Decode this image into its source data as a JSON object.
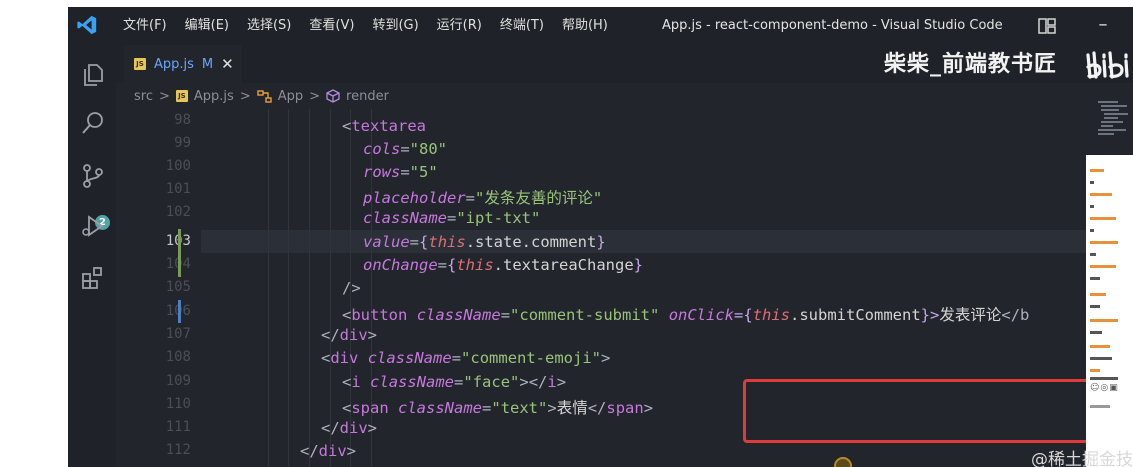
{
  "titlebar": {
    "menus": [
      "文件(F)",
      "编辑(E)",
      "选择(S)",
      "查看(V)",
      "转到(G)",
      "运行(R)",
      "终端(T)",
      "帮助(H)"
    ],
    "window_title": "App.js - react-component-demo - Visual Studio Code",
    "minimize": "–"
  },
  "activitybar": {
    "icons": [
      "files-icon",
      "search-icon",
      "source-control-icon",
      "run-debug-icon",
      "extensions-icon"
    ],
    "scm_badge": "2"
  },
  "tab": {
    "file_name": "App.js",
    "modified_marker": "M",
    "close": "✕",
    "file_type_badge": "JS"
  },
  "watermark": {
    "author": "柴柴_前端教书匠",
    "site": "@稀土掘金技术社区"
  },
  "breadcrumb": {
    "items": [
      "src",
      "App.js",
      "App",
      "render"
    ],
    "separator": ">"
  },
  "editor": {
    "line_numbers": [
      "98",
      "99",
      "100",
      "101",
      "102",
      "103",
      "104",
      "105",
      "106",
      "107",
      "108",
      "109",
      "110",
      "111",
      "112"
    ],
    "active_line": "103",
    "code": {
      "l98": {
        "open": "<",
        "tag": "textarea"
      },
      "l99": {
        "attr": "cols",
        "eq": "=",
        "value": "\"80\""
      },
      "l100": {
        "attr": "rows",
        "eq": "=",
        "value": "\"5\""
      },
      "l101": {
        "attr": "placeholder",
        "eq": "=",
        "value": "\"发条友善的评论\""
      },
      "l102": {
        "attr": "className",
        "eq": "=",
        "value": "\"ipt-txt\""
      },
      "l103": {
        "attr": "value",
        "eq": "=",
        "open": "{",
        "this": "this",
        "rest": ".state.comment",
        "close": "}"
      },
      "l104": {
        "attr": "onChange",
        "eq": "=",
        "open": "{",
        "this": "this",
        "rest": ".textareaChange",
        "close": "}"
      },
      "l105": {
        "text": "/>"
      },
      "l106": {
        "open": "<",
        "tag": "button",
        "attr1": "className",
        "eq": "=",
        "value": "\"comment-submit\"",
        "attr2": "onClick",
        "eq2": "={",
        "this": "this",
        "rest": ".submitComment",
        "close": "}>",
        "text": "发表评论",
        "end": "</b"
      },
      "l107": {
        "open": "</",
        "tag": "div",
        "close": ">"
      },
      "l108": {
        "open": "<",
        "tag": "div",
        "attr": "className",
        "eq": "=",
        "value": "\"comment-emoji\"",
        "close": ">"
      },
      "l109": {
        "open": "<",
        "tag": "i",
        "attr": "className",
        "eq": "=",
        "value": "\"face\"",
        "close": "></",
        "tag2": "i",
        "close2": ">"
      },
      "l110": {
        "open": "<",
        "tag": "span",
        "attr": "className",
        "eq": "=",
        "value": "\"text\"",
        "close": ">",
        "text": "表情",
        "open2": "</",
        "tag2": "span",
        "close2": ">"
      },
      "l111": {
        "open": "</",
        "tag": "div",
        "close": ">"
      },
      "l112": {
        "open": "</",
        "tag": "div",
        "close": ">"
      }
    }
  },
  "colors": {
    "background": "#22252c",
    "highlight_box": "#e03b3b",
    "tab_accent": "#6aa6ff",
    "badge": "#4fa3a8"
  }
}
